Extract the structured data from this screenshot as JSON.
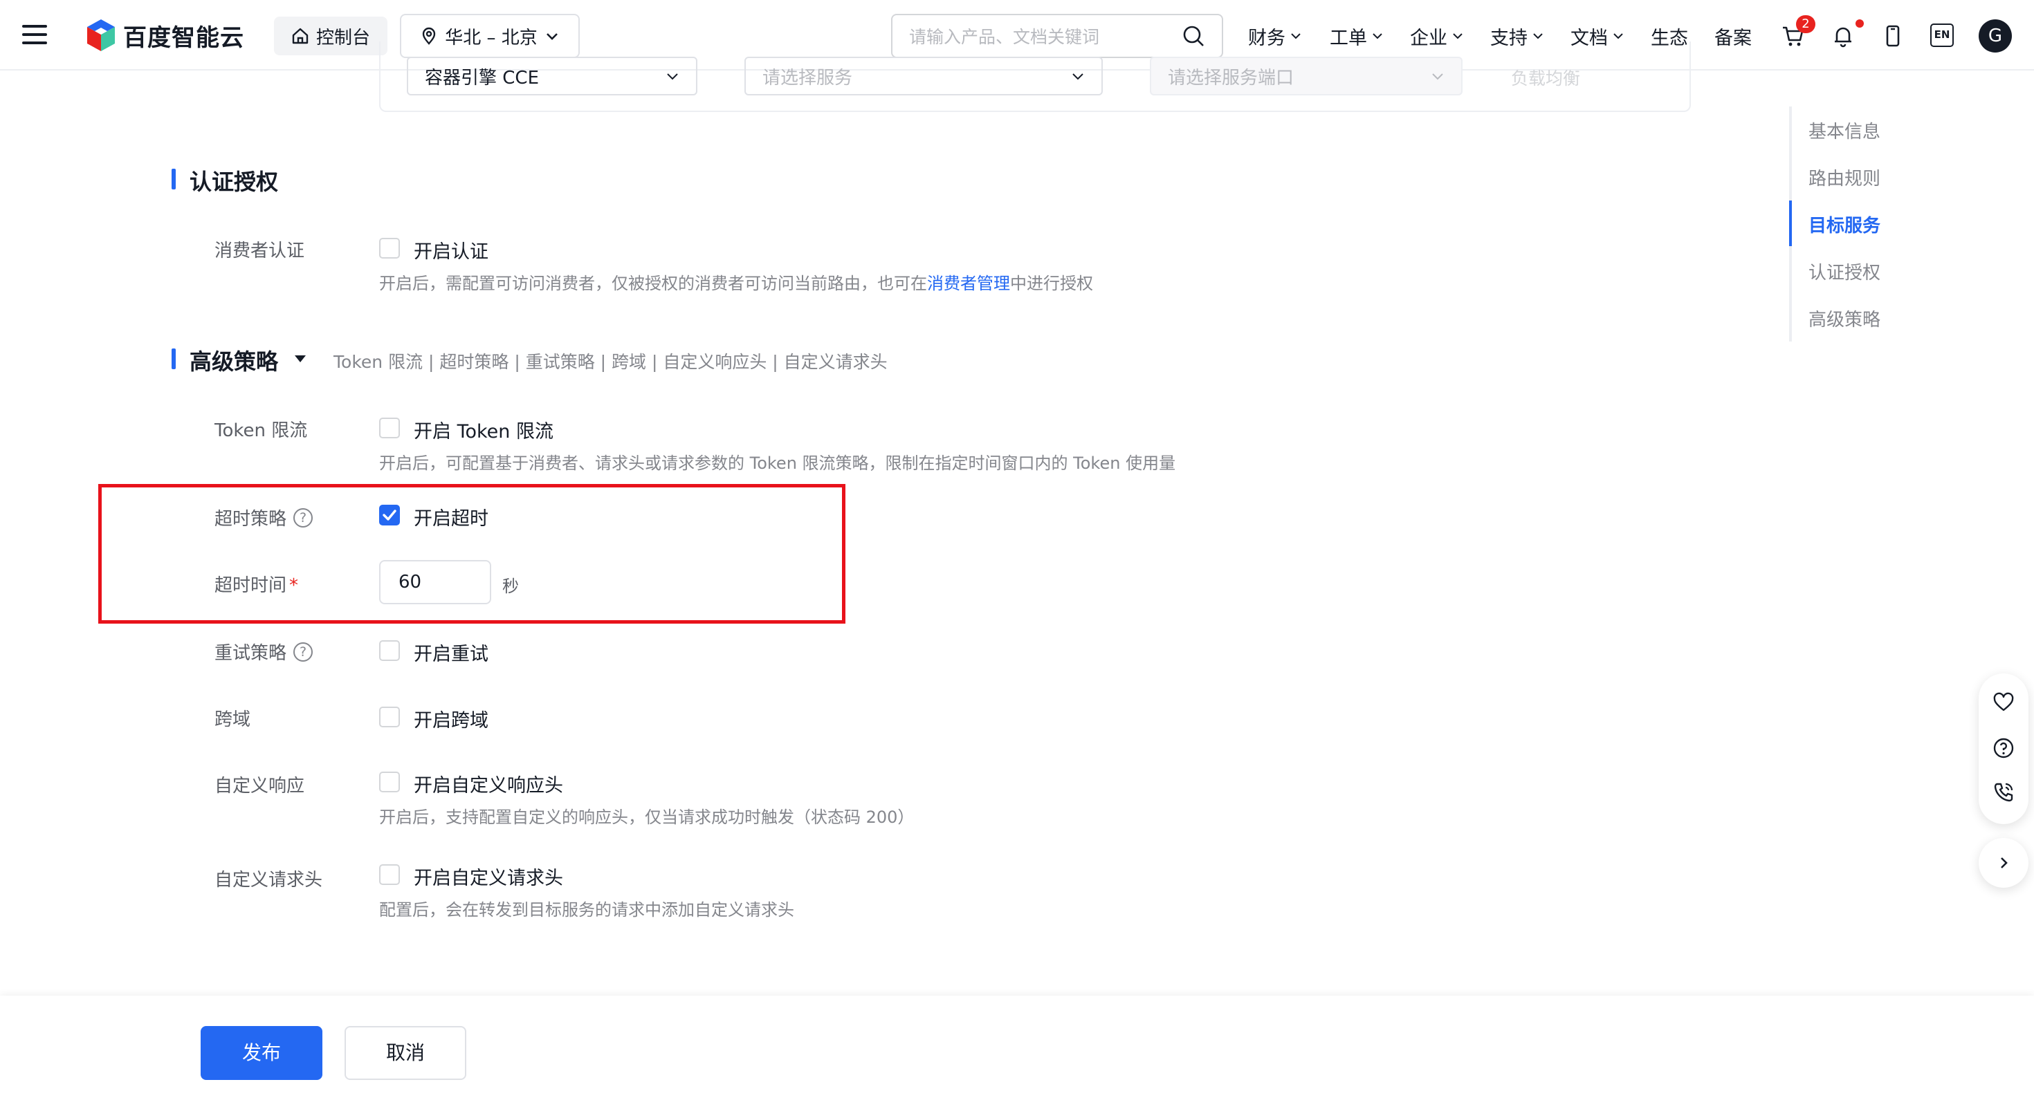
{
  "topnav": {
    "brand": "百度智能云",
    "console": "控制台",
    "region": "华北 – 北京",
    "search_placeholder": "请输入产品、文档关键词",
    "menu": [
      "财务",
      "工单",
      "企业",
      "支持",
      "文档",
      "生态",
      "备案"
    ],
    "cart_badge": "2",
    "lang": "EN",
    "avatar_letter": "G"
  },
  "target_service_row": {
    "source_value": "容器引擎 CCE",
    "service_placeholder": "请选择服务",
    "port_placeholder": "请选择服务端口",
    "lb_label": "负载均衡"
  },
  "auth_section": {
    "title": "认证授权",
    "consumer_label": "消费者认证",
    "consumer_checkbox": "开启认证",
    "consumer_desc_pre": "开启后，需配置可访问消费者，仅被授权的消费者可访问当前路由，也可在",
    "consumer_desc_link": "消费者管理",
    "consumer_desc_post": "中进行授权"
  },
  "advanced_section": {
    "title": "高级策略",
    "summary": "Token 限流 | 超时策略 | 重试策略 | 跨域 | 自定义响应头 | 自定义请求头",
    "token_label": "Token 限流",
    "token_checkbox": "开启 Token 限流",
    "token_desc": "开启后，可配置基于消费者、请求头或请求参数的 Token 限流策略，限制在指定时间窗口内的 Token 使用量",
    "timeout_label": "超时策略",
    "timeout_checkbox": "开启超时",
    "timeout_checked": true,
    "timeout_time_label": "超时时间",
    "timeout_value": "60",
    "timeout_unit": "秒",
    "retry_label": "重试策略",
    "retry_checkbox": "开启重试",
    "cors_label": "跨域",
    "cors_checkbox": "开启跨域",
    "resp_label": "自定义响应",
    "resp_checkbox": "开启自定义响应头",
    "resp_desc": "开启后，支持配置自定义的响应头，仅当请求成功时触发（状态码 200）",
    "req_label": "自定义请求头",
    "req_checkbox": "开启自定义请求头",
    "req_desc": "配置后，会在转发到目标服务的请求中添加自定义请求头"
  },
  "anchor_nav": [
    "基本信息",
    "路由规则",
    "目标服务",
    "认证授权",
    "高级策略"
  ],
  "anchor_active": "目标服务",
  "footer": {
    "publish": "发布",
    "cancel": "取消"
  },
  "colors": {
    "primary": "#2468f2",
    "highlight_box": "#e8121b",
    "required": "#e8231f"
  }
}
